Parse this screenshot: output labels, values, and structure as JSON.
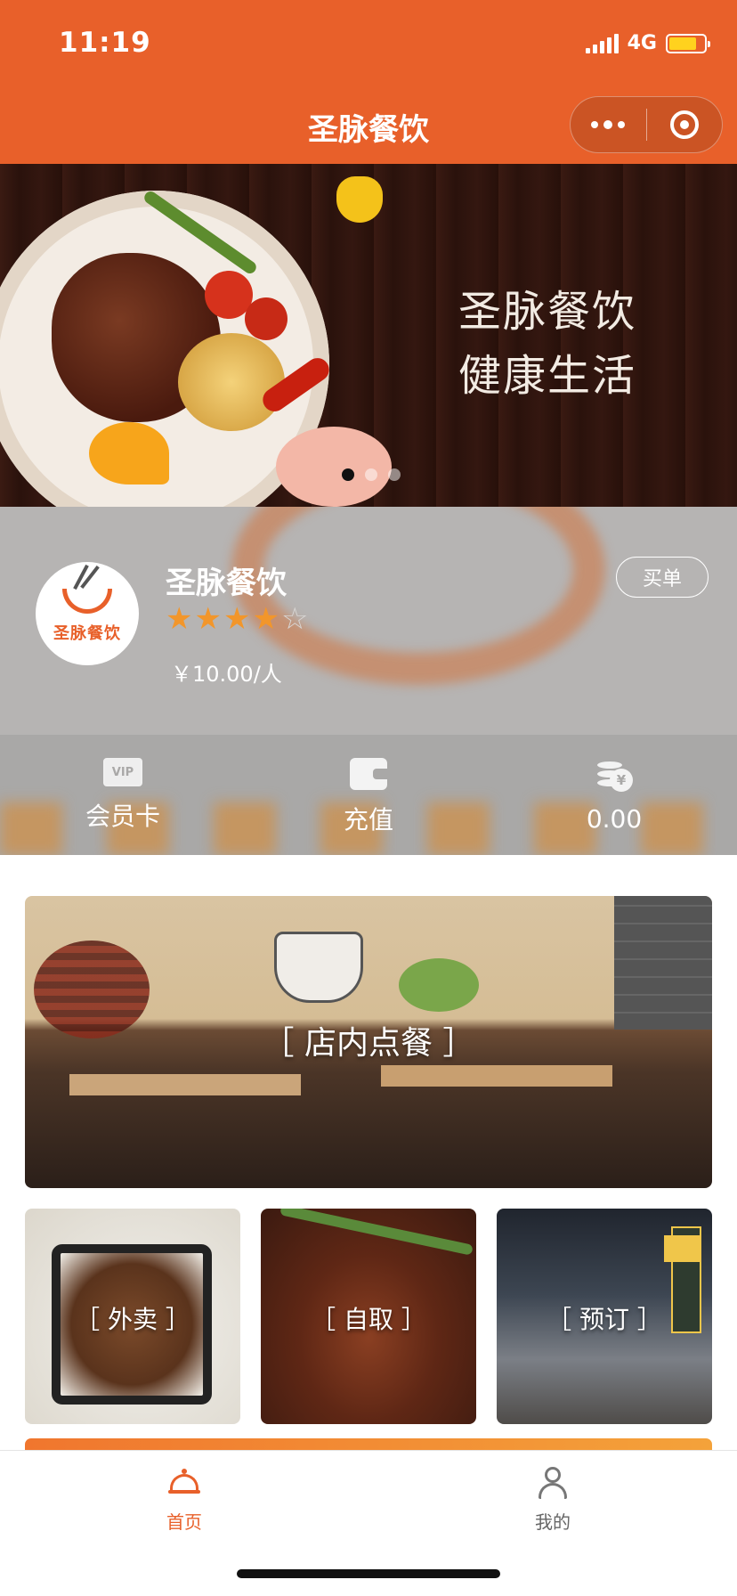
{
  "status_bar": {
    "time": "11:19",
    "network": "4G"
  },
  "nav": {
    "title": "圣脉餐饮"
  },
  "banner": {
    "line1": "圣脉餐饮",
    "line2": "健康生活",
    "slide_count": 3,
    "active_slide": 1
  },
  "store": {
    "name": "圣脉餐饮",
    "logo_text": "圣脉餐饮",
    "rating": 4,
    "rating_max": 5,
    "price": "￥10.00/人",
    "buy_button": "买单"
  },
  "stats": [
    {
      "icon": "vip-card-icon",
      "icon_text": "VIP",
      "label": "会员卡"
    },
    {
      "icon": "wallet-icon",
      "label": "充值"
    },
    {
      "icon": "coins-icon",
      "label": "0.00"
    }
  ],
  "ordering": {
    "dine_in": "［ 店内点餐 ］",
    "delivery": "［ 外卖 ］",
    "pickup": "［ 自取 ］",
    "reserve": "［ 预订 ］"
  },
  "tabbar": [
    {
      "label": "首页",
      "icon": "cloche-icon",
      "active": true
    },
    {
      "label": "我的",
      "icon": "person-icon",
      "active": false
    }
  ],
  "colors": {
    "brand": "#e8602a",
    "star": "#f2962b"
  }
}
